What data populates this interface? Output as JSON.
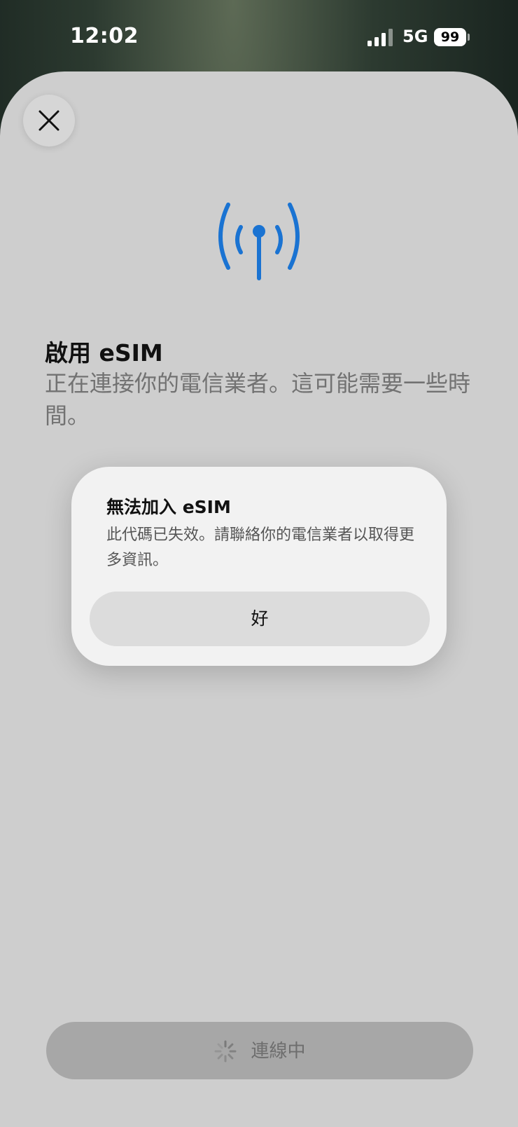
{
  "status_bar": {
    "time": "12:02",
    "network": "5G",
    "battery": "99"
  },
  "page": {
    "title": "啟用 eSIM",
    "subtitle": "正在連接你的電信業者。這可能需要一些時間。"
  },
  "alert": {
    "title": "無法加入 eSIM",
    "message": "此代碼已失效。請聯絡你的電信業者以取得更多資訊。",
    "button_label": "好"
  },
  "footer": {
    "connect_label": "連線中"
  },
  "colors": {
    "accent": "#1a73d2",
    "sheet_background": "#cecece",
    "alert_background": "#f2f2f2"
  },
  "icons": {
    "close": "close-icon",
    "antenna": "antenna-signal-icon",
    "spinner": "activity-spinner-icon",
    "signal": "cellular-signal-icon",
    "battery": "battery-icon"
  }
}
